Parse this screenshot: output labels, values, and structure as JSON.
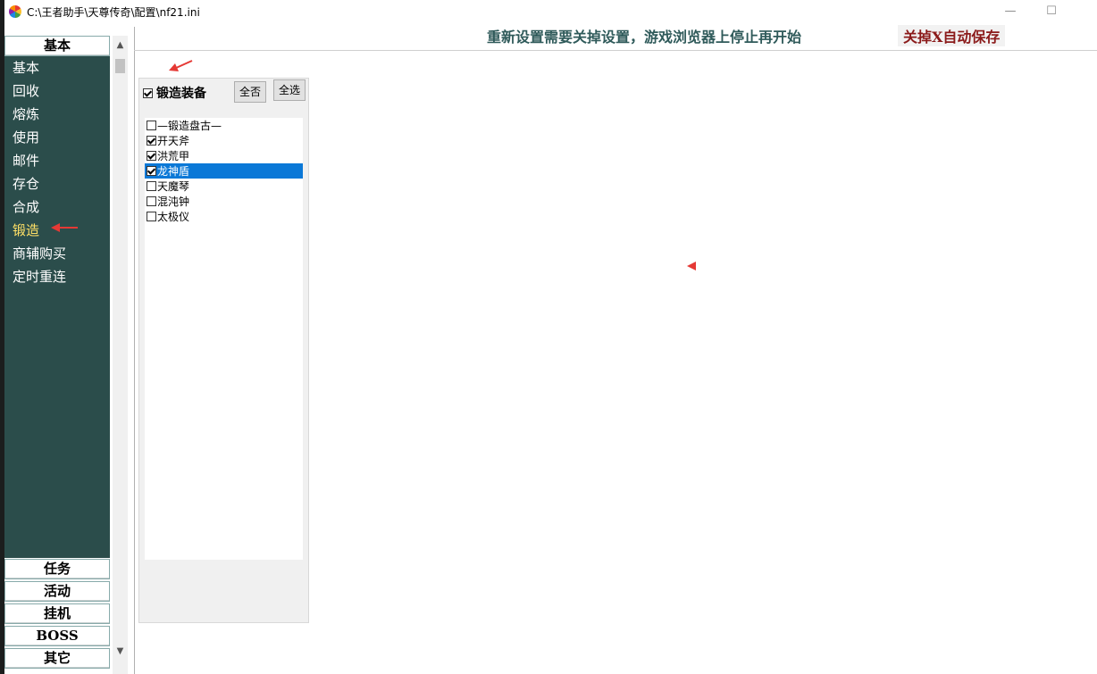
{
  "window": {
    "title": "C:\\王者助手\\天尊传奇\\配置\\nf21.ini",
    "minimize_glyph": "—",
    "maximize_glyph": "☐"
  },
  "nav": {
    "header": "基本",
    "items": [
      "基本",
      "回收",
      "熔炼",
      "使用",
      "邮件",
      "存仓",
      "合成",
      "锻造",
      "商辅购买",
      "定时重连"
    ],
    "active_item": "锻造",
    "bottom_buttons": [
      "任务",
      "活动",
      "挂机",
      "BOSS",
      "其它"
    ]
  },
  "scrollbar": {
    "up_glyph": "▲",
    "down_glyph": "▼"
  },
  "notice": {
    "main": "重新设置需要关掉设置，游戏浏览器上停止再开始",
    "save": "关掉X自动保存"
  },
  "forge": {
    "label": "锻造装备",
    "checked": true,
    "btn_none": "全否",
    "btn_all": "全选",
    "items": [
      {
        "label": "—锻造盘古—",
        "checked": false,
        "selected": false
      },
      {
        "label": "开天斧",
        "checked": true,
        "selected": false
      },
      {
        "label": "洪荒甲",
        "checked": true,
        "selected": false
      },
      {
        "label": "龙神盾",
        "checked": true,
        "selected": true
      },
      {
        "label": "天魔琴",
        "checked": false,
        "selected": false
      },
      {
        "label": "混沌钟",
        "checked": false,
        "selected": false
      },
      {
        "label": "太极仪",
        "checked": false,
        "selected": false
      }
    ]
  },
  "colors": {
    "nav_bg": "#2b4d4b",
    "nav_active": "#ffe066",
    "selection": "#0a78d7",
    "annotation_arrow": "#e53935"
  }
}
